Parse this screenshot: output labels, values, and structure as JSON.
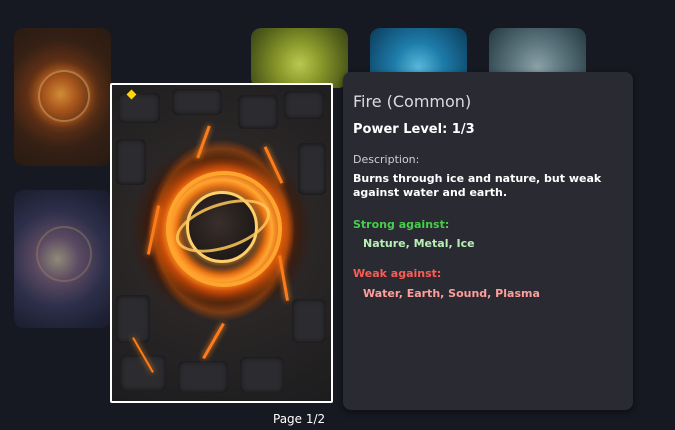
{
  "cards": {
    "background": [
      {
        "element": "fire"
      },
      {
        "element": "nature"
      },
      {
        "element": "water"
      },
      {
        "element": "metal"
      },
      {
        "element": "energy"
      }
    ],
    "selected": {
      "element": "fire",
      "rarity_icon": "diamond-icon",
      "rarity_color": "#ffd700"
    }
  },
  "info": {
    "title": "Fire (Common)",
    "power_level": "Power Level: 1/3",
    "description_label": "Description:",
    "description": "Burns through ice and nature, but weak against water and earth.",
    "strong_label": "Strong against:",
    "strong_list": "Nature, Metal, Ice",
    "weak_label": "Weak against:",
    "weak_list": "Water, Earth, Sound, Plasma"
  },
  "pagination": {
    "label": "Page 1/2"
  },
  "colors": {
    "background": "#161822",
    "panel": "#2a2b32",
    "strong": "#45cf4a",
    "weak": "#ff5b55",
    "selection_border": "#ffffff"
  }
}
